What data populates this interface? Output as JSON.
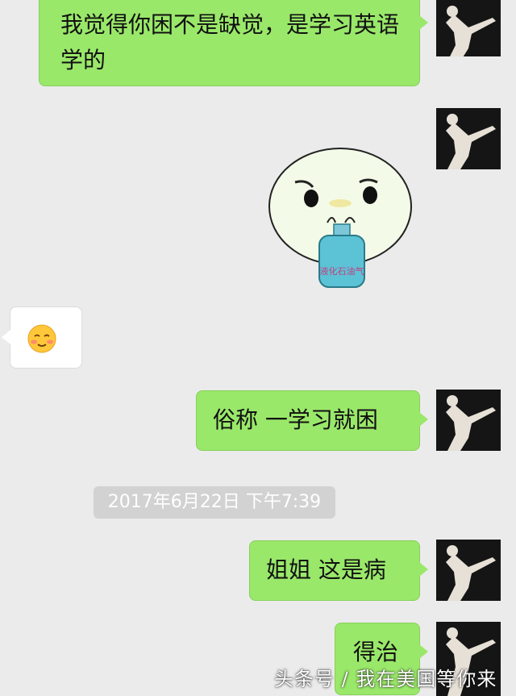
{
  "messages": [
    {
      "side": "right",
      "kind": "text",
      "text": "我觉得你困不是缺觉，是学习英语学的"
    },
    {
      "side": "right",
      "kind": "sticker",
      "icon": "cartoon-gas-tank-sticker",
      "text": "液化石油气"
    },
    {
      "side": "left",
      "kind": "emoji",
      "icon": "blushing-smile-emoji"
    },
    {
      "side": "right",
      "kind": "text",
      "text": "俗称 一学习就困"
    },
    {
      "side": "right",
      "kind": "text",
      "text": "姐姐 这是病"
    },
    {
      "side": "right",
      "kind": "text",
      "text": "得治"
    }
  ],
  "timestamp": "2017年6月22日 下午7:39",
  "watermark": "头条号 / 我在美国等你来",
  "colors": {
    "background": "#ebebeb",
    "sent_bubble": "#9ae86a",
    "received_bubble": "#ffffff",
    "timestamp_bg": "#d2d2d2"
  }
}
